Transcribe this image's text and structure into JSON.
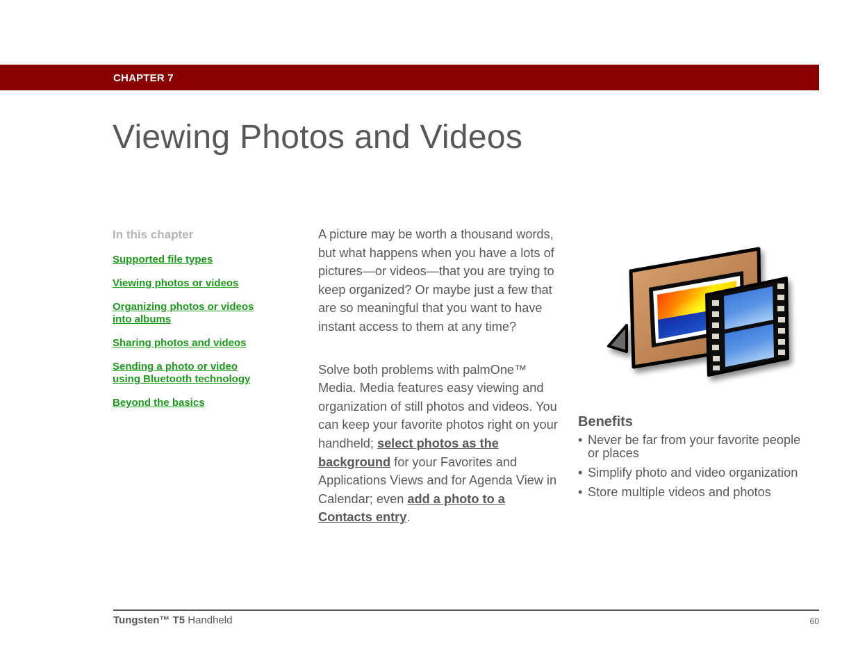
{
  "header": {
    "chapter_label": "CHAPTER 7",
    "band_color": "#8b0000"
  },
  "title": "Viewing Photos and Videos",
  "toc": {
    "heading": "In this chapter",
    "link_color": "#1b9a1b",
    "items": [
      {
        "label": "Supported file types"
      },
      {
        "label": "Viewing photos or videos"
      },
      {
        "label": "Organizing photos or videos \ninto albums"
      },
      {
        "label": "Sharing photos and videos"
      },
      {
        "label": "Sending a photo or video \nusing Bluetooth technology"
      },
      {
        "label": "Beyond the basics"
      }
    ]
  },
  "body": {
    "paragraph1": "A picture may be worth a thousand words, but what happens when you have a lots of pictures—or videos—that you are trying to keep organized? Or maybe just a few that are so meaningful that you want to have instant access to them at any time?",
    "paragraph2": {
      "text_before": "Solve both problems with palmOne™ Media. Media features easy viewing and organization of still photos and videos. You can keep your favorite photos right on your handheld; ",
      "link1": "select photos as the background",
      "text_middle": " for your Favorites and Applications Views and for Agenda View in Calendar; even ",
      "link2": "add a photo to a Contacts entry",
      "text_after": "."
    }
  },
  "illustration": {
    "icon": "media-app-icon",
    "description": "Picture frame with sunset photo and film strip"
  },
  "benefits": {
    "heading": "Benefits",
    "bullet": "•",
    "items": [
      {
        "text": "Never be far from your favorite people or places"
      },
      {
        "text": "Simplify photo and video organization"
      },
      {
        "text": "Store multiple videos and photos"
      }
    ]
  },
  "footer": {
    "brand": "Tungsten™ T5",
    "product": " Handheld",
    "page_number": "60"
  }
}
